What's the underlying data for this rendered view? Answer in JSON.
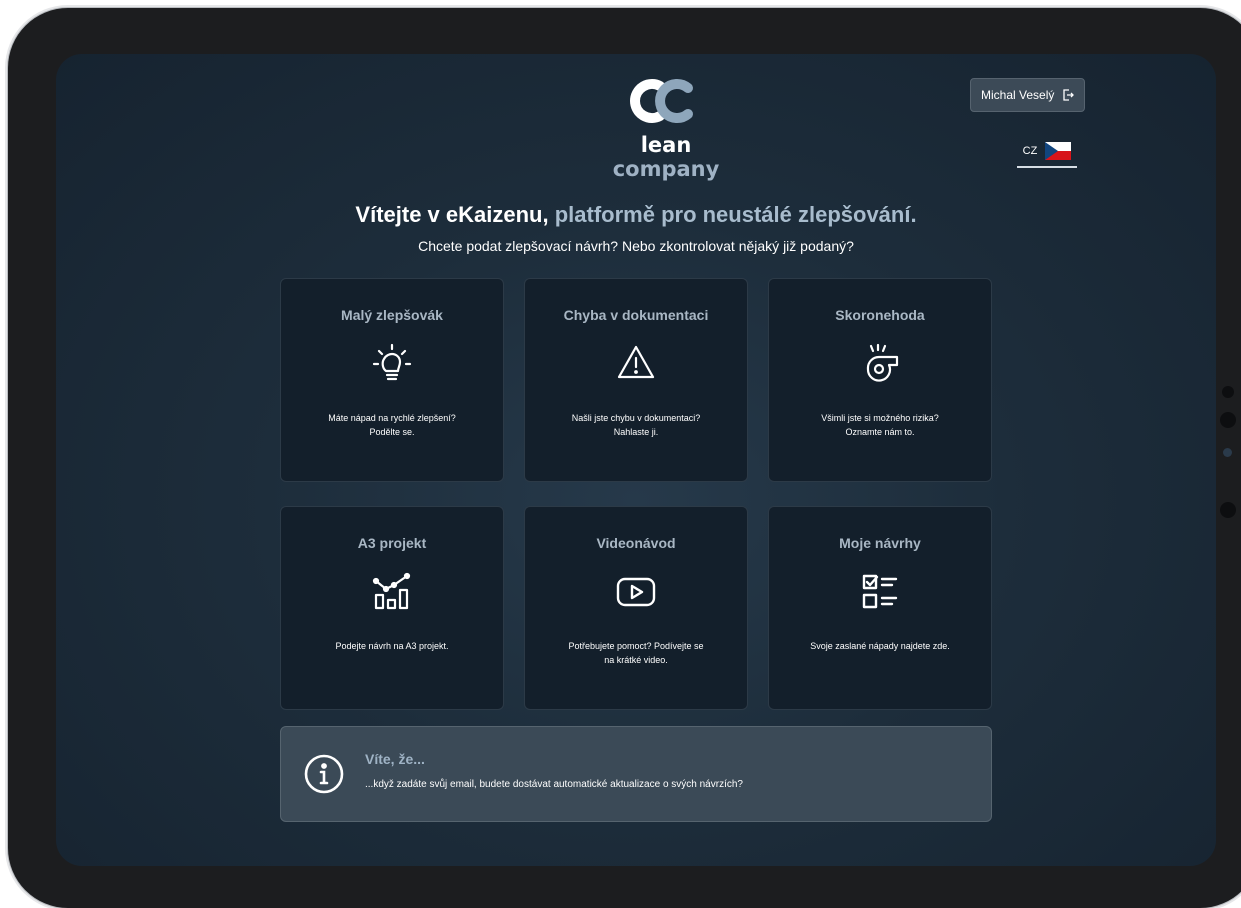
{
  "header": {
    "logo": {
      "name_part1": "lean",
      "name_part2": "company"
    },
    "user_name": "Michal Veselý",
    "language": "CZ"
  },
  "hero": {
    "title_part1": "Vítejte v eKaizenu,",
    "title_part2": "platformě pro neustálé zlepšování.",
    "subtitle": "Chcete podat zlepšovací návrh? Nebo zkontrolovat nějaký již podaný?"
  },
  "cards": [
    {
      "title": "Malý zlepšovák",
      "icon": "lightbulb-icon",
      "description": "Máte nápad na rychlé zlepšení?\nPodělte se."
    },
    {
      "title": "Chyba v dokumentaci",
      "icon": "warning-triangle-icon",
      "description": "Našli jste chybu v dokumentaci?\nNahlaste ji."
    },
    {
      "title": "Skoronehoda",
      "icon": "whistle-icon",
      "description": "Všimli jste si možného rizika?\nOznamte nám to."
    },
    {
      "title": "A3 projekt",
      "icon": "chart-icon",
      "description": "Podejte návrh na A3 projekt."
    },
    {
      "title": "Videonávod",
      "icon": "video-play-icon",
      "description": "Potřebujete pomoct? Podívejte se\nna krátké video."
    },
    {
      "title": "Moje návrhy",
      "icon": "checklist-icon",
      "description": "Svoje zaslané nápady najdete zde."
    }
  ],
  "info": {
    "title": "Víte, že...",
    "text": "...když zadáte svůj email, budete dostávat automatické aktualizace o svých návrzích?"
  }
}
